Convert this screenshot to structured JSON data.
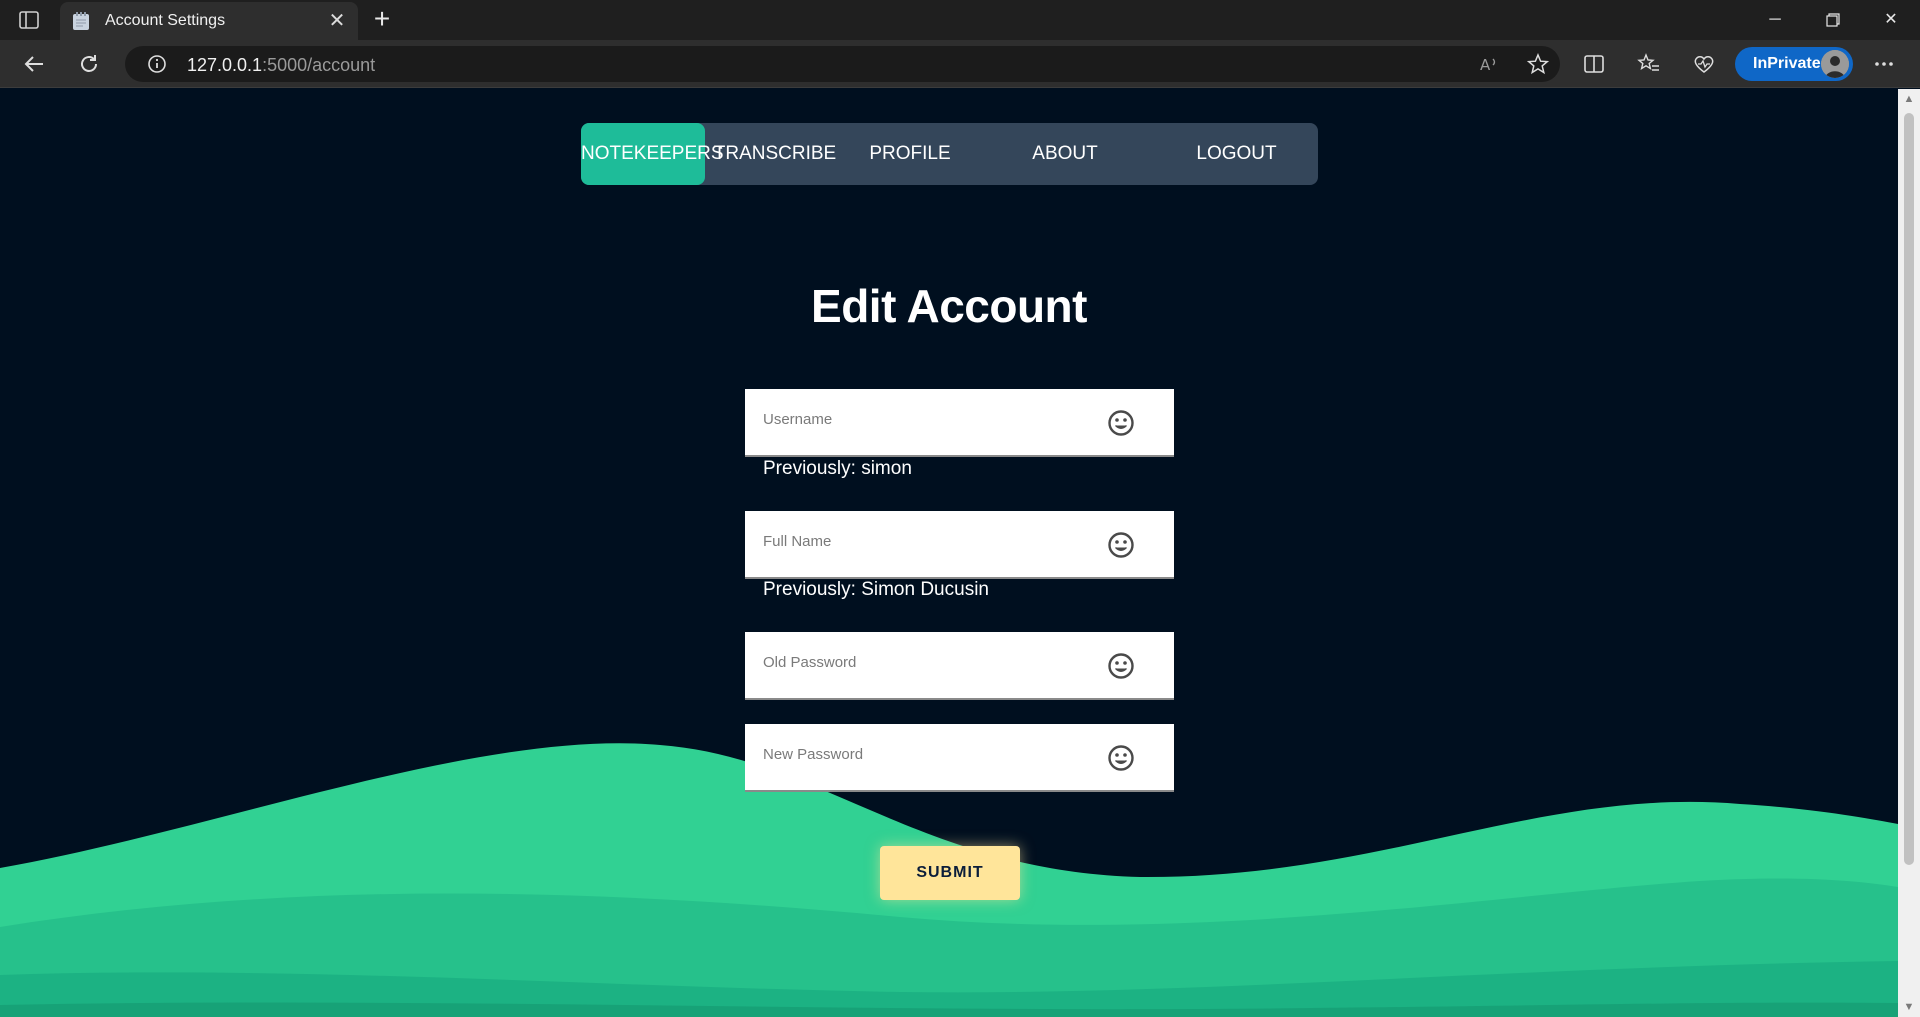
{
  "browser": {
    "tab_title": "Account Settings",
    "url_host": "127.0.0.1",
    "url_rest": ":5000/account",
    "inprivate_label": "InPrivate"
  },
  "nav": {
    "items": [
      {
        "label": "NOTEKEEPERS",
        "active": true
      },
      {
        "label": "TRANSCRIBE",
        "active": false
      },
      {
        "label": "PROFILE",
        "active": false
      },
      {
        "label": "ABOUT",
        "active": false
      },
      {
        "label": "LOGOUT",
        "active": false
      }
    ]
  },
  "form": {
    "title": "Edit Account",
    "fields": [
      {
        "label": "Username",
        "value": "",
        "previous": "Previously: simon"
      },
      {
        "label": "Full Name",
        "value": "",
        "previous": "Previously: Simon Ducusin"
      },
      {
        "label": "Old Password",
        "value": ""
      },
      {
        "label": "New Password",
        "value": ""
      }
    ],
    "submit_label": "SUBMIT"
  },
  "colors": {
    "page_bg": "#000f1f",
    "nav_bg": "#34465a",
    "nav_active": "#1ebc99",
    "wave_light": "#31d193",
    "wave_mid": "#26c18b",
    "wave_dark": "#1cb283",
    "submit_bg": "#ffe59a"
  }
}
